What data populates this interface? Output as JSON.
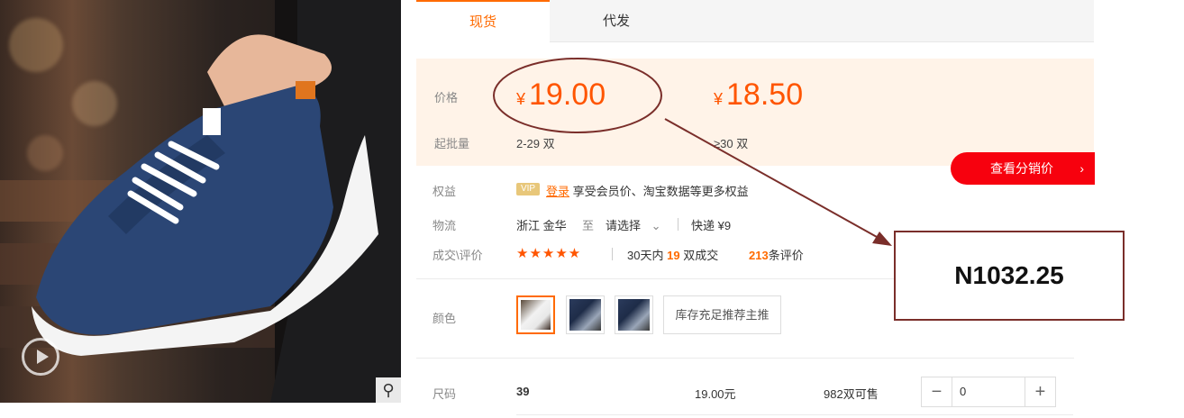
{
  "tabs": [
    {
      "label": "现货",
      "active": true
    },
    {
      "label": "代发",
      "active": false
    }
  ],
  "price": {
    "label": "价格",
    "currency": "¥",
    "tiers": [
      {
        "price": "19.00",
        "range": "2-29 双"
      },
      {
        "price": "18.50",
        "range": "≥30 双"
      }
    ],
    "min_label": "起批量"
  },
  "distributor_button": {
    "label": "查看分销价",
    "chevron": "›"
  },
  "benefits": {
    "label": "权益",
    "vip_badge": "VIP",
    "login_link": "登录",
    "text": "享受会员价、淘宝数据等更多权益"
  },
  "logistics": {
    "label": "物流",
    "origin": "浙江 金华",
    "to_label": "至",
    "destination": "请选择",
    "shipping": "快递 ¥9"
  },
  "reviews": {
    "label": "成交\\评价",
    "stars": "★★★★★",
    "prefix": "30天内",
    "sold": "19",
    "sold_suffix": "双成交",
    "review_count": "213",
    "review_suffix": "条评价"
  },
  "colors": {
    "label": "颜色",
    "note": "库存充足推荐主推"
  },
  "size": {
    "label": "尺码",
    "value": "39",
    "price": "19.00元",
    "stock": "982双可售",
    "quantity": "0"
  },
  "annotation": {
    "text": "N1032.25",
    "color": "#7a2e2a"
  },
  "icons": {
    "play": "play-icon",
    "zoom": "magnifier-icon",
    "dropdown": "chevron-down-icon"
  }
}
